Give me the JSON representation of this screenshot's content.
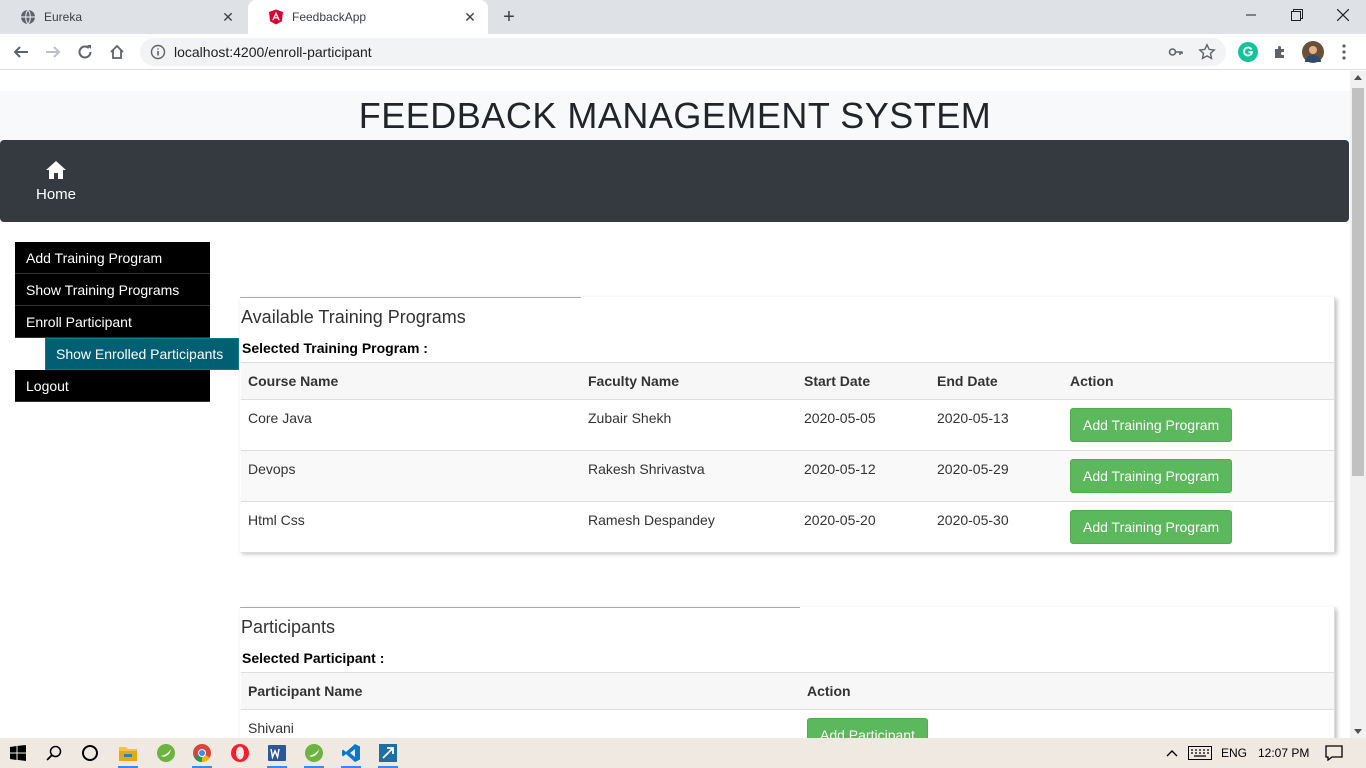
{
  "browser": {
    "tabs": [
      {
        "title": "Eureka",
        "icon": "globe-icon"
      },
      {
        "title": "FeedbackApp",
        "icon": "angular-icon"
      }
    ],
    "url": "localhost:4200/enroll-participant"
  },
  "app": {
    "title": "FEEDBACK MANAGEMENT SYSTEM",
    "nav": {
      "home": "Home"
    }
  },
  "sidebar": {
    "items": [
      {
        "label": "Add Training Program"
      },
      {
        "label": "Show Training Programs"
      },
      {
        "label": "Enroll Participant"
      },
      {
        "label": "Show Enrolled Participants"
      },
      {
        "label": "Logout"
      }
    ]
  },
  "programs": {
    "title": "Available Training Programs",
    "selected_label": "Selected Training Program :",
    "columns": [
      "Course Name",
      "Faculty Name",
      "Start Date",
      "End Date",
      "Action"
    ],
    "rows": [
      {
        "course": "Core Java",
        "faculty": "Zubair Shekh",
        "start": "2020-05-05",
        "end": "2020-05-13",
        "action": "Add Training Program"
      },
      {
        "course": "Devops",
        "faculty": "Rakesh Shrivastva",
        "start": "2020-05-12",
        "end": "2020-05-29",
        "action": "Add Training Program"
      },
      {
        "course": "Html Css",
        "faculty": "Ramesh Despandey",
        "start": "2020-05-20",
        "end": "2020-05-30",
        "action": "Add Training Program"
      }
    ]
  },
  "participants": {
    "title": "Participants",
    "selected_label": "Selected Participant :",
    "columns": [
      "Participant Name",
      "Action"
    ],
    "rows": [
      {
        "name": "Shivani",
        "action": "Add Participant"
      }
    ]
  },
  "taskbar": {
    "lang": "ENG",
    "time": "12:07 PM"
  },
  "colors": {
    "navbar": "#343a40",
    "menu": "#000000",
    "menu_active": "#005f73",
    "button": "#5cb85c"
  }
}
